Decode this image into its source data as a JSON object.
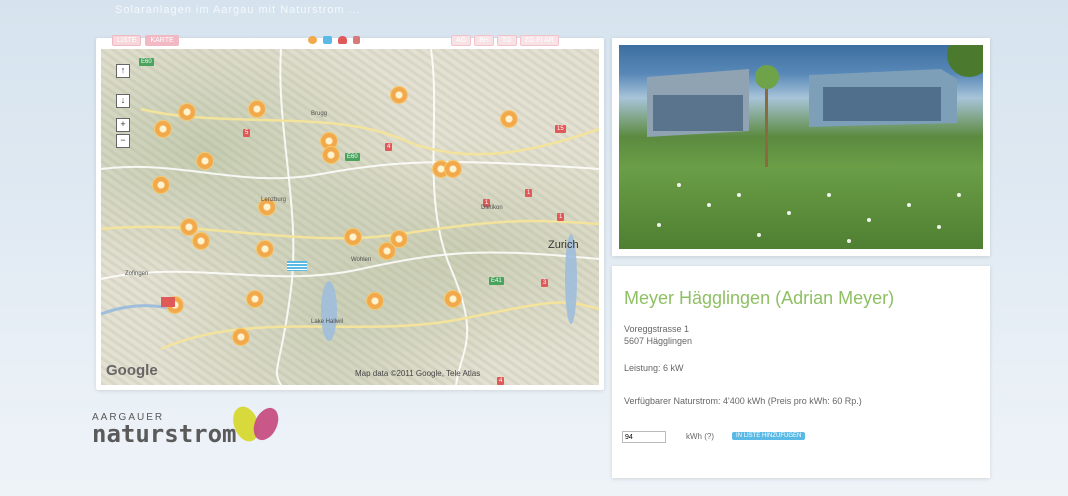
{
  "page": {
    "top_text": "Solaranlagen im Aargau mit Naturstrom ..."
  },
  "map_panel": {
    "tabs": [
      {
        "label": "LISTE"
      },
      {
        "label": "KARTE"
      }
    ],
    "regions": [
      "AG",
      "BH",
      "TG",
      "ZG FI AR"
    ],
    "type_icons": [
      {
        "name": "sun",
        "color": "#f2a94b"
      },
      {
        "name": "water",
        "color": "#5bb9e6"
      },
      {
        "name": "biomass",
        "color": "#e05959"
      },
      {
        "name": "wind",
        "color": "#d97a7a"
      }
    ],
    "labels": [
      "Zurich",
      "Map data ©2011 Google, Tele Atlas",
      "Google"
    ],
    "zoom": [
      "+",
      "−",
      "↑",
      "↓"
    ]
  },
  "profile": {
    "title": "Meyer Hägglingen (Adrian Meyer)",
    "address_line1": "Voreggstrasse 1",
    "address_line2": "5607 Hägglingen",
    "leistung": "Leistung: 6 kW",
    "available": "Verfügbarer Naturstrom: 4'400 kWh (Preis pro kWh: 60 Rp.)",
    "kwh_value": "94",
    "kwh_label": "kWh (?)",
    "cart_button": "IN LISTE HINZUFÜGEN"
  },
  "logo": {
    "top": "AARGAUER",
    "main": "naturstrom",
    "colors": [
      "#d8d93b",
      "#c74f83"
    ]
  }
}
